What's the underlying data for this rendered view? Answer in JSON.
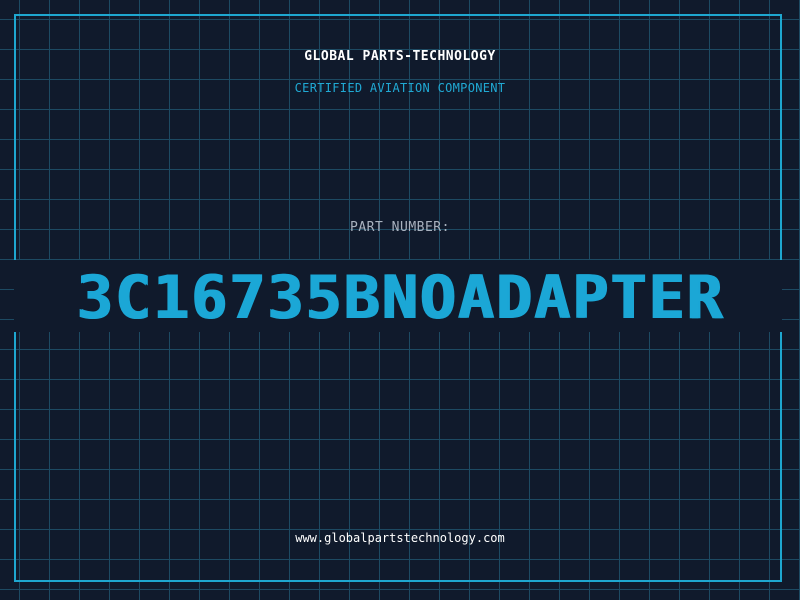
{
  "header": {
    "company": "GLOBAL PARTS-TECHNOLOGY",
    "subtitle": "CERTIFIED AVIATION COMPONENT"
  },
  "part": {
    "label": "PART NUMBER:",
    "number": "3C16735BNOADAPTER"
  },
  "footer": {
    "website": "www.globalpartstechnology.com"
  },
  "colors": {
    "background": "#101a2c",
    "grid": "#1d4a63",
    "accent": "#1ea7d0",
    "text": "#ffffff",
    "muted": "#a9b2bf"
  }
}
